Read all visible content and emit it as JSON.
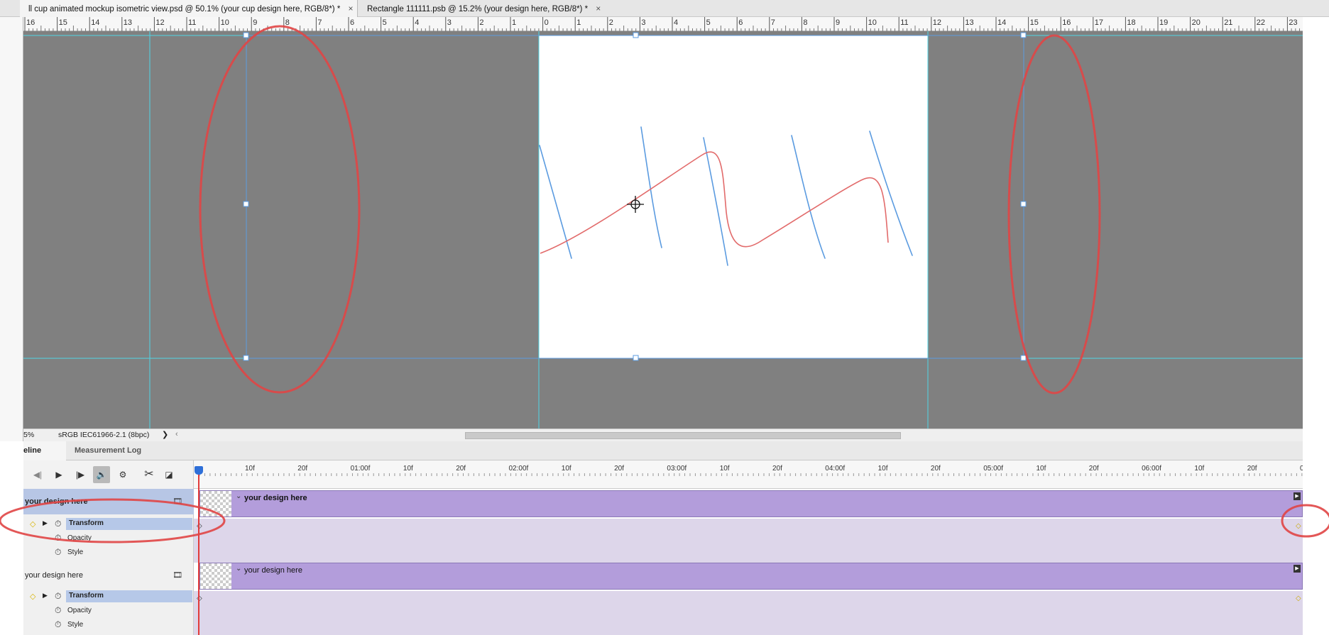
{
  "tabs": [
    {
      "title": "ll cup animated mockup isometric view.psd @ 50.1% (your cup design here, RGB/8*) *",
      "close": "×"
    },
    {
      "title": "Rectangle 111111.psb @ 15.2% (your design here, RGB/8*) *",
      "close": "×"
    }
  ],
  "ruler": {
    "top_labels": [
      "16",
      "15",
      "14",
      "13",
      "12",
      "11",
      "10",
      "9",
      "8",
      "7",
      "6",
      "5",
      "4",
      "3",
      "2",
      "1",
      "0",
      "1",
      "2",
      "3",
      "4",
      "5",
      "6",
      "7",
      "8",
      "9",
      "10",
      "11",
      "12",
      "13",
      "14",
      "15",
      "16",
      "17",
      "18",
      "19",
      "20",
      "21",
      "22",
      "23"
    ]
  },
  "status": {
    "zoom": "5%",
    "color_profile": "sRGB IEC61966-2.1 (8bpc)",
    "arrow_right": "❯",
    "arrow_left": "‹"
  },
  "panel_tabs": {
    "timeline": "eline",
    "measurement_log": "Measurement Log"
  },
  "controls": {
    "prev": "◀|",
    "play": "▶",
    "next": "|▶",
    "audio": "🔊",
    "settings": "⚙",
    "split": "✂",
    "transition": "◪"
  },
  "time_ruler": {
    "labels": [
      "10f",
      "20f",
      "01:00f",
      "10f",
      "20f",
      "02:00f",
      "10f",
      "20f",
      "03:00f",
      "10f",
      "20f",
      "04:00f",
      "10f",
      "20f",
      "05:00f",
      "10f",
      "20f",
      "06:00f",
      "10f",
      "20f",
      "07:"
    ]
  },
  "layers": [
    {
      "name": "your design here",
      "selected": true,
      "properties": [
        "Transform",
        "Opacity",
        "Style"
      ]
    },
    {
      "name": "your design here",
      "selected": false,
      "properties": [
        "Transform",
        "Opacity",
        "Style"
      ]
    }
  ],
  "clips": [
    {
      "label": "your design here"
    },
    {
      "label": "your design here"
    }
  ],
  "icons": {
    "film": "🎞",
    "chevron": "⌄",
    "watch": "⏱",
    "diamond": "◇",
    "triangle": "▶",
    "keyframe": "◆"
  },
  "colors": {
    "canvas_bg": "#808080",
    "guide": "#4fd6e6",
    "path_blue": "#5b9be0",
    "path_red": "#e26b6b",
    "annotation": "#e04545",
    "clip": "#b39ddb",
    "track": "#ddd6ea",
    "selection": "#b7c6e5"
  }
}
